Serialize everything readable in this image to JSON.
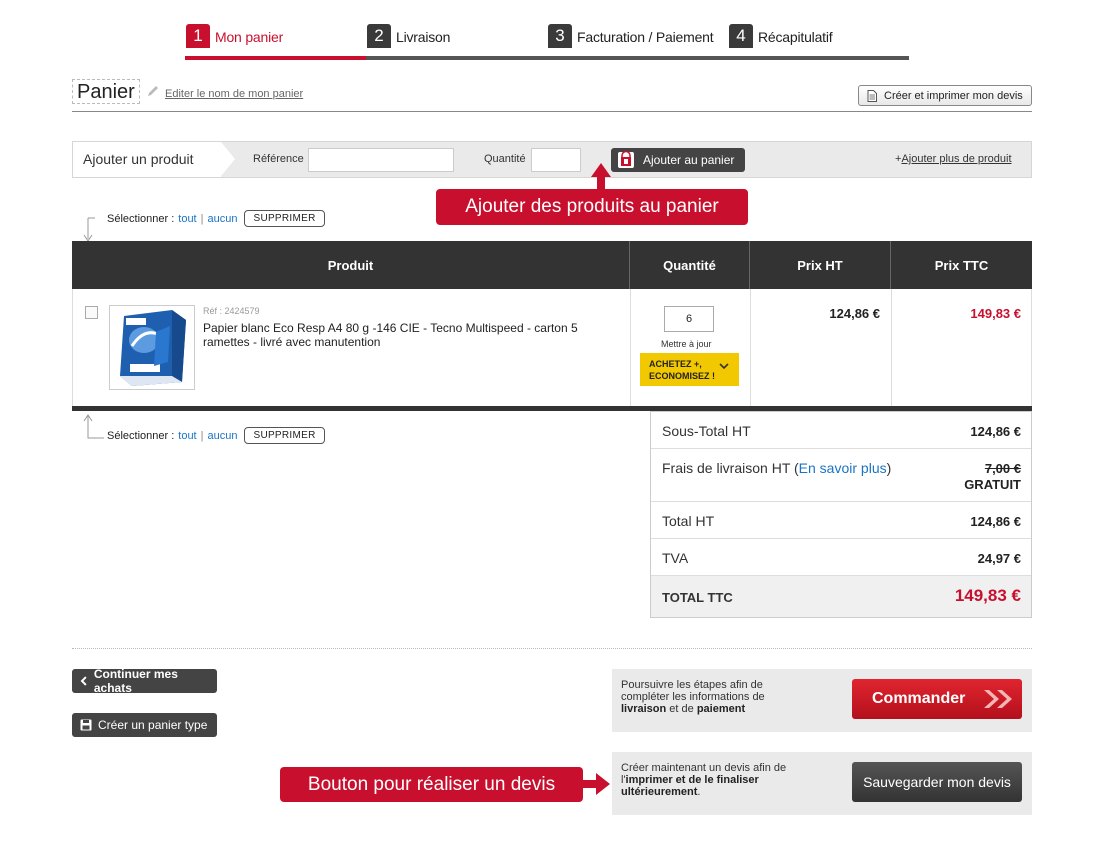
{
  "steps": [
    {
      "num": "1",
      "label": "Mon panier"
    },
    {
      "num": "2",
      "label": "Livraison"
    },
    {
      "num": "3",
      "label": "Facturation / Paiement"
    },
    {
      "num": "4",
      "label": "Récapitulatif"
    }
  ],
  "header": {
    "title": "Panier",
    "edit_link": "Editer le nom de mon panier",
    "devis_button": "Créer et imprimer mon devis"
  },
  "add_bar": {
    "label": "Ajouter un produit",
    "ref_label": "Référence",
    "qty_label": "Quantité",
    "add_button": "Ajouter au panier",
    "more_link": "Ajouter plus de produit"
  },
  "callouts": {
    "add_products": "Ajouter des produits au panier",
    "devis": "Bouton pour réaliser un devis"
  },
  "select": {
    "label": "Sélectionner :",
    "all": "tout",
    "sep": "|",
    "none": "aucun",
    "delete": "SUPPRIMER"
  },
  "table": {
    "headers": [
      "Produit",
      "Quantité",
      "Prix HT",
      "Prix TTC"
    ],
    "rows": [
      {
        "ref": "Réf : 2424579",
        "name": "Papier blanc Eco Resp A4 80 g -146 CIE - Tecno Multispeed - carton 5 ramettes - livré avec manutention",
        "qty": "6",
        "update": "Mettre à jour",
        "promo_line1": "ACHETEZ +,",
        "promo_line2": "ECONOMISEZ !",
        "price_ht": "124,86 €",
        "price_ttc": "149,83 €"
      }
    ]
  },
  "totals": {
    "subtotal_label": "Sous-Total HT",
    "subtotal": "124,86 €",
    "shipping_label": "Frais de livraison HT (",
    "shipping_link": "En savoir plus",
    "shipping_close": ")",
    "shipping_old": "7,00 €",
    "shipping_free": "GRATUIT",
    "total_ht_label": "Total HT",
    "total_ht": "124,86 €",
    "tva_label": "TVA",
    "tva": "24,97 €",
    "total_ttc_label": "TOTAL TTC",
    "total_ttc": "149,83 €"
  },
  "actions": {
    "continue": "Continuer mes achats",
    "panier_type": "Créer un panier type",
    "order_text_1": "Poursuivre les étapes afin de compléter les informations de ",
    "order_text_b1": "livraison",
    "order_text_2": " et de ",
    "order_text_b2": "paiement",
    "order_button": "Commander",
    "devis_text_1": "Créer maintenant un devis afin de l'",
    "devis_text_b1": "imprimer et de le finaliser ultérieurement",
    "devis_text_2": ".",
    "save_button": "Sauvegarder mon devis"
  },
  "colors": {
    "accent": "#c8102e",
    "dark": "#333333",
    "promo": "#f2c800",
    "link": "#1a74c4"
  }
}
